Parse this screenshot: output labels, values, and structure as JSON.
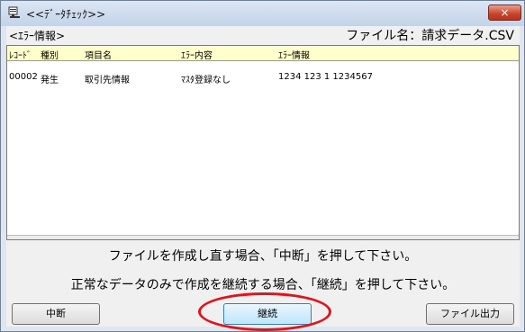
{
  "window": {
    "title": "<<ﾃﾞｰﾀﾁｪｯｸ>>",
    "close_label": "×",
    "app_icon": "app-icon"
  },
  "panel": {
    "error_info_label": "<ｴﾗｰ情報>",
    "file_name_label": "ファイル名：請求データ.CSV"
  },
  "grid": {
    "columns": [
      "ﾚｺｰﾄﾞ",
      "種別",
      "項目名",
      "ｴﾗｰ内容",
      "ｴﾗｰ情報"
    ],
    "rows": [
      [
        "00002",
        "発生",
        "取引先情報",
        "ﾏｽﾀ登録なし",
        "1234 123 1 1234567"
      ]
    ]
  },
  "messages": {
    "line1": "ファイルを作成し直す場合、「中断」を押して下さい。",
    "line2": "正常なデータのみで作成を継続する場合、「継続」を押して下さい。"
  },
  "buttons": {
    "stop": "中断",
    "continue": "継続",
    "export": "ファイル出力"
  },
  "colors": {
    "highlight": "#e0141e",
    "grid_header": "#ffffcc"
  }
}
